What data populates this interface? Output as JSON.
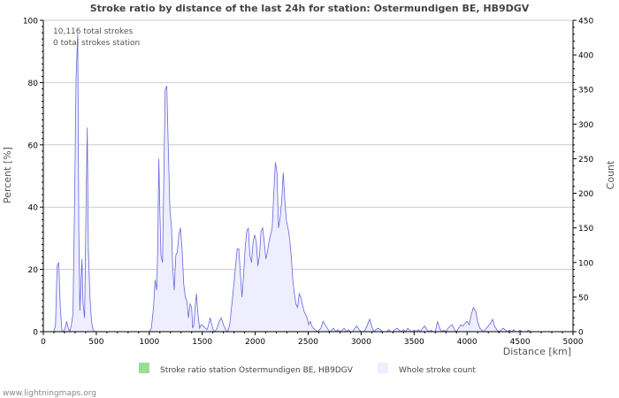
{
  "chart_data": {
    "type": "area",
    "title": "Stroke ratio by distance of the last 24h for station: Ostermundigen BE, HB9DGV",
    "xlabel": "Distance   [km]",
    "ylabel_left": "Percent   [%]",
    "ylabel_right": "Count",
    "xlim": [
      0,
      5000
    ],
    "ylim_left": [
      0,
      100
    ],
    "ylim_right": [
      0,
      450
    ],
    "x_ticks": [
      0,
      500,
      1000,
      1500,
      2000,
      2500,
      3000,
      3500,
      4000,
      4500,
      5000
    ],
    "y_left_ticks": [
      0,
      20,
      40,
      60,
      80,
      100
    ],
    "y_right_ticks": [
      0,
      50,
      100,
      150,
      200,
      250,
      300,
      350,
      400,
      450
    ],
    "grid": "horizontal",
    "annotations": [
      "10,116 total strokes",
      "0 total strokes station"
    ],
    "legend_position": "bottom",
    "series": [
      {
        "name": "Stroke ratio station Ostermundigen BE, HB9DGV",
        "color": "#99dd99",
        "axis": "left",
        "points": []
      },
      {
        "name": "Whole stroke count",
        "color": "#6666dd",
        "fill": "#eeeeff",
        "axis": "right",
        "points": [
          [
            100,
            0
          ],
          [
            115,
            10
          ],
          [
            130,
            95
          ],
          [
            145,
            100
          ],
          [
            160,
            35
          ],
          [
            175,
            2
          ],
          [
            190,
            0
          ],
          [
            205,
            5
          ],
          [
            220,
            15
          ],
          [
            235,
            5
          ],
          [
            250,
            0
          ],
          [
            265,
            10
          ],
          [
            280,
            25
          ],
          [
            295,
            180
          ],
          [
            310,
            370
          ],
          [
            325,
            430
          ],
          [
            335,
            150
          ],
          [
            345,
            30
          ],
          [
            355,
            70
          ],
          [
            365,
            105
          ],
          [
            375,
            40
          ],
          [
            390,
            20
          ],
          [
            405,
            200
          ],
          [
            415,
            295
          ],
          [
            425,
            120
          ],
          [
            440,
            50
          ],
          [
            455,
            15
          ],
          [
            470,
            2
          ],
          [
            490,
            0
          ],
          [
            520,
            0
          ],
          [
            560,
            0
          ],
          [
            600,
            0
          ],
          [
            650,
            0
          ],
          [
            700,
            0
          ],
          [
            750,
            0
          ],
          [
            800,
            0
          ],
          [
            850,
            0
          ],
          [
            900,
            0
          ],
          [
            950,
            0
          ],
          [
            1000,
            0
          ],
          [
            1020,
            5
          ],
          [
            1040,
            35
          ],
          [
            1055,
            75
          ],
          [
            1070,
            60
          ],
          [
            1080,
            120
          ],
          [
            1090,
            250
          ],
          [
            1100,
            175
          ],
          [
            1110,
            110
          ],
          [
            1125,
            100
          ],
          [
            1135,
            200
          ],
          [
            1150,
            350
          ],
          [
            1165,
            355
          ],
          [
            1180,
            260
          ],
          [
            1195,
            175
          ],
          [
            1210,
            150
          ],
          [
            1220,
            95
          ],
          [
            1235,
            60
          ],
          [
            1250,
            110
          ],
          [
            1265,
            115
          ],
          [
            1280,
            140
          ],
          [
            1295,
            150
          ],
          [
            1310,
            120
          ],
          [
            1325,
            70
          ],
          [
            1340,
            50
          ],
          [
            1355,
            45
          ],
          [
            1370,
            20
          ],
          [
            1385,
            40
          ],
          [
            1400,
            35
          ],
          [
            1410,
            5
          ],
          [
            1420,
            10
          ],
          [
            1430,
            30
          ],
          [
            1445,
            55
          ],
          [
            1460,
            25
          ],
          [
            1475,
            5
          ],
          [
            1490,
            10
          ],
          [
            1510,
            8
          ],
          [
            1530,
            5
          ],
          [
            1545,
            3
          ],
          [
            1560,
            10
          ],
          [
            1575,
            20
          ],
          [
            1590,
            10
          ],
          [
            1605,
            2
          ],
          [
            1620,
            0
          ],
          [
            1640,
            5
          ],
          [
            1660,
            15
          ],
          [
            1680,
            20
          ],
          [
            1700,
            10
          ],
          [
            1720,
            3
          ],
          [
            1740,
            0
          ],
          [
            1760,
            10
          ],
          [
            1780,
            40
          ],
          [
            1800,
            70
          ],
          [
            1815,
            95
          ],
          [
            1830,
            120
          ],
          [
            1845,
            120
          ],
          [
            1860,
            85
          ],
          [
            1875,
            50
          ],
          [
            1890,
            80
          ],
          [
            1905,
            120
          ],
          [
            1920,
            145
          ],
          [
            1935,
            150
          ],
          [
            1950,
            110
          ],
          [
            1965,
            100
          ],
          [
            1980,
            130
          ],
          [
            1995,
            140
          ],
          [
            2010,
            130
          ],
          [
            2025,
            95
          ],
          [
            2040,
            110
          ],
          [
            2055,
            145
          ],
          [
            2070,
            150
          ],
          [
            2085,
            130
          ],
          [
            2100,
            105
          ],
          [
            2115,
            115
          ],
          [
            2130,
            130
          ],
          [
            2145,
            140
          ],
          [
            2160,
            150
          ],
          [
            2175,
            200
          ],
          [
            2190,
            245
          ],
          [
            2205,
            230
          ],
          [
            2220,
            150
          ],
          [
            2235,
            165
          ],
          [
            2250,
            190
          ],
          [
            2265,
            230
          ],
          [
            2280,
            190
          ],
          [
            2295,
            160
          ],
          [
            2310,
            150
          ],
          [
            2325,
            135
          ],
          [
            2340,
            110
          ],
          [
            2355,
            75
          ],
          [
            2370,
            55
          ],
          [
            2385,
            40
          ],
          [
            2400,
            35
          ],
          [
            2415,
            55
          ],
          [
            2430,
            50
          ],
          [
            2445,
            40
          ],
          [
            2460,
            30
          ],
          [
            2475,
            25
          ],
          [
            2490,
            20
          ],
          [
            2505,
            10
          ],
          [
            2520,
            15
          ],
          [
            2535,
            8
          ],
          [
            2550,
            5
          ],
          [
            2565,
            3
          ],
          [
            2580,
            0
          ],
          [
            2600,
            2
          ],
          [
            2620,
            5
          ],
          [
            2640,
            15
          ],
          [
            2660,
            10
          ],
          [
            2680,
            5
          ],
          [
            2700,
            0
          ],
          [
            2720,
            2
          ],
          [
            2740,
            5
          ],
          [
            2760,
            0
          ],
          [
            2780,
            3
          ],
          [
            2800,
            0
          ],
          [
            2820,
            2
          ],
          [
            2840,
            5
          ],
          [
            2860,
            0
          ],
          [
            2880,
            3
          ],
          [
            2900,
            0
          ],
          [
            2920,
            0
          ],
          [
            2940,
            5
          ],
          [
            2960,
            8
          ],
          [
            2980,
            3
          ],
          [
            3000,
            0
          ],
          [
            3020,
            0
          ],
          [
            3040,
            3
          ],
          [
            3060,
            10
          ],
          [
            3080,
            18
          ],
          [
            3100,
            8
          ],
          [
            3120,
            0
          ],
          [
            3140,
            3
          ],
          [
            3160,
            5
          ],
          [
            3180,
            3
          ],
          [
            3200,
            0
          ],
          [
            3220,
            0
          ],
          [
            3240,
            0
          ],
          [
            3260,
            3
          ],
          [
            3280,
            0
          ],
          [
            3300,
            0
          ],
          [
            3320,
            3
          ],
          [
            3340,
            5
          ],
          [
            3360,
            2
          ],
          [
            3380,
            0
          ],
          [
            3400,
            3
          ],
          [
            3420,
            0
          ],
          [
            3440,
            5
          ],
          [
            3460,
            2
          ],
          [
            3480,
            0
          ],
          [
            3500,
            2
          ],
          [
            3520,
            0
          ],
          [
            3540,
            3
          ],
          [
            3560,
            0
          ],
          [
            3580,
            5
          ],
          [
            3600,
            8
          ],
          [
            3620,
            3
          ],
          [
            3640,
            0
          ],
          [
            3660,
            2
          ],
          [
            3680,
            0
          ],
          [
            3700,
            0
          ],
          [
            3720,
            15
          ],
          [
            3740,
            5
          ],
          [
            3760,
            0
          ],
          [
            3780,
            2
          ],
          [
            3800,
            0
          ],
          [
            3820,
            5
          ],
          [
            3840,
            8
          ],
          [
            3860,
            10
          ],
          [
            3880,
            3
          ],
          [
            3900,
            0
          ],
          [
            3920,
            5
          ],
          [
            3940,
            10
          ],
          [
            3960,
            8
          ],
          [
            3980,
            12
          ],
          [
            4000,
            15
          ],
          [
            4020,
            10
          ],
          [
            4040,
            25
          ],
          [
            4060,
            35
          ],
          [
            4080,
            30
          ],
          [
            4100,
            15
          ],
          [
            4120,
            5
          ],
          [
            4140,
            2
          ],
          [
            4160,
            0
          ],
          [
            4180,
            5
          ],
          [
            4200,
            8
          ],
          [
            4220,
            12
          ],
          [
            4240,
            18
          ],
          [
            4260,
            8
          ],
          [
            4280,
            3
          ],
          [
            4300,
            0
          ],
          [
            4320,
            2
          ],
          [
            4340,
            5
          ],
          [
            4360,
            3
          ],
          [
            4380,
            0
          ],
          [
            4400,
            2
          ],
          [
            4420,
            0
          ],
          [
            4440,
            3
          ],
          [
            4460,
            0
          ],
          [
            4480,
            0
          ],
          [
            4500,
            2
          ],
          [
            4520,
            0
          ],
          [
            4540,
            0
          ],
          [
            4560,
            0
          ],
          [
            4580,
            2
          ],
          [
            4600,
            0
          ],
          [
            4620,
            0
          ],
          [
            4650,
            0
          ]
        ]
      }
    ]
  },
  "footer": {
    "credit": "www.lightningmaps.org"
  }
}
